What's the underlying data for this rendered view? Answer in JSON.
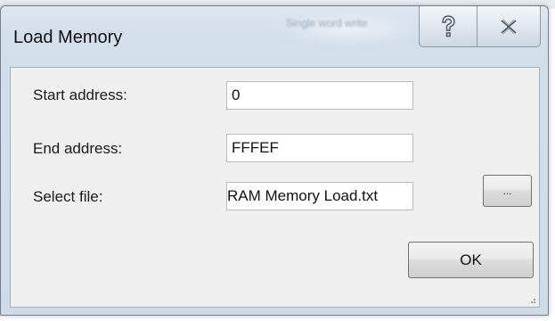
{
  "window": {
    "title": "Load Memory",
    "background_title": "Single word write"
  },
  "caption_buttons": {
    "help_icon": "help-question-icon",
    "close_icon": "close-x-icon"
  },
  "form": {
    "start_address": {
      "label": "Start address:",
      "value": "0"
    },
    "end_address": {
      "label": "End address:",
      "value": "FFFEF"
    },
    "select_file": {
      "label": "Select file:",
      "value": "RAM Memory Load.txt",
      "browse_label": "..."
    }
  },
  "actions": {
    "ok_label": "OK"
  },
  "colors": {
    "frame": "#d3dfeb",
    "client": "#f0f0f0",
    "field": "#ffffff"
  }
}
